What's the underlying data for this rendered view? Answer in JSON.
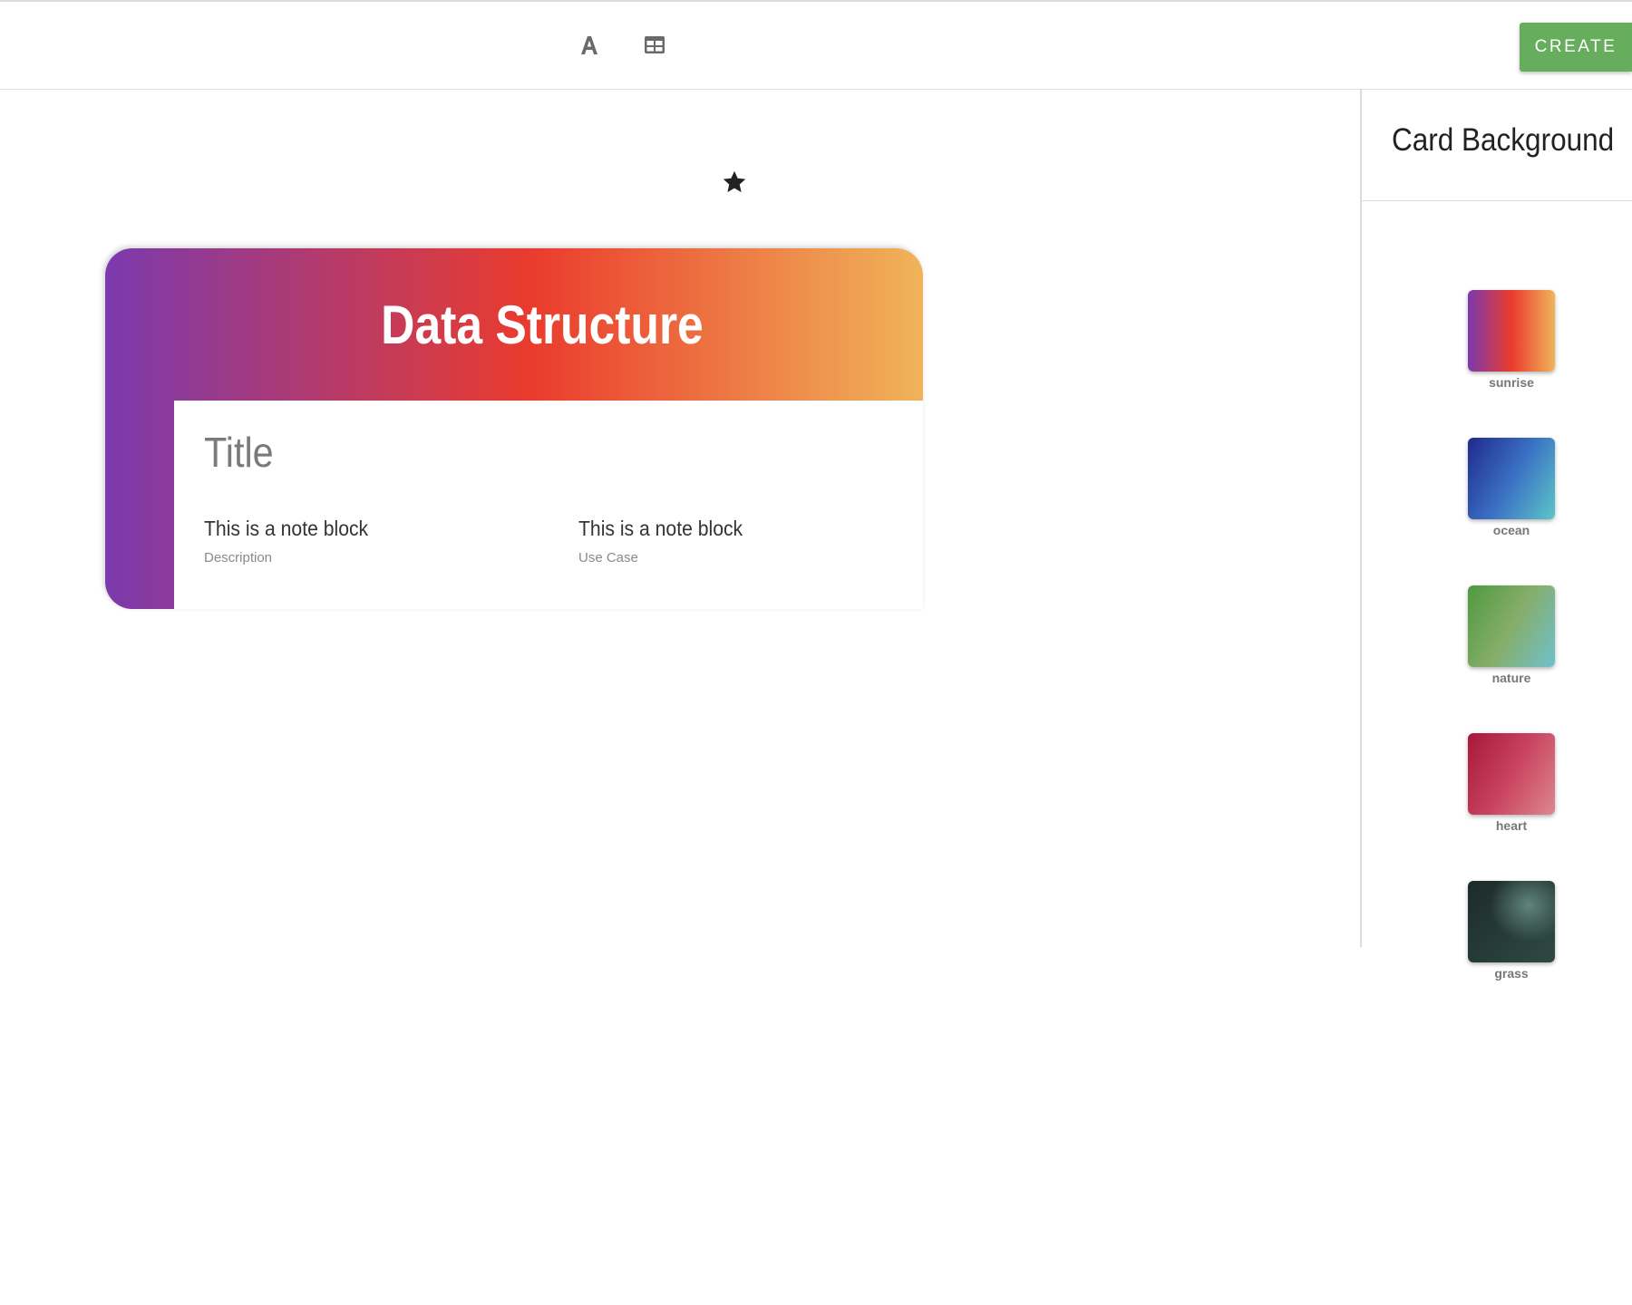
{
  "toolbar": {
    "font_tool_icon": "font-letter-icon",
    "table_tool_icon": "table-grid-icon",
    "create_label": "CREATE",
    "create_color": "#66ae5d"
  },
  "card": {
    "heading": "Data Structure",
    "title": "Title",
    "star_icon": "star-icon",
    "gradient": [
      "#7b3aae",
      "#ea3b2d",
      "#f0b45a"
    ],
    "notes": [
      {
        "text": "This is a note block",
        "label": "Description"
      },
      {
        "text": "This is a note block",
        "label": "Use Case"
      }
    ]
  },
  "panel": {
    "title": "Card Background",
    "swatches": [
      {
        "name": "sunrise",
        "colors": [
          "#7b3aae",
          "#ea3b2d",
          "#f0b45a"
        ]
      },
      {
        "name": "ocean",
        "colors": [
          "#1f2a8c",
          "#3a6fc4",
          "#5cc6c8"
        ]
      },
      {
        "name": "nature",
        "colors": [
          "#4e9a3f",
          "#86ad6a",
          "#6fc1cb"
        ]
      },
      {
        "name": "heart",
        "colors": [
          "#a6183a",
          "#c9435f",
          "#dd8792"
        ]
      },
      {
        "name": "grass",
        "colors": [
          "#1d2b28",
          "#2f4a43",
          "#5f857a"
        ]
      }
    ]
  }
}
